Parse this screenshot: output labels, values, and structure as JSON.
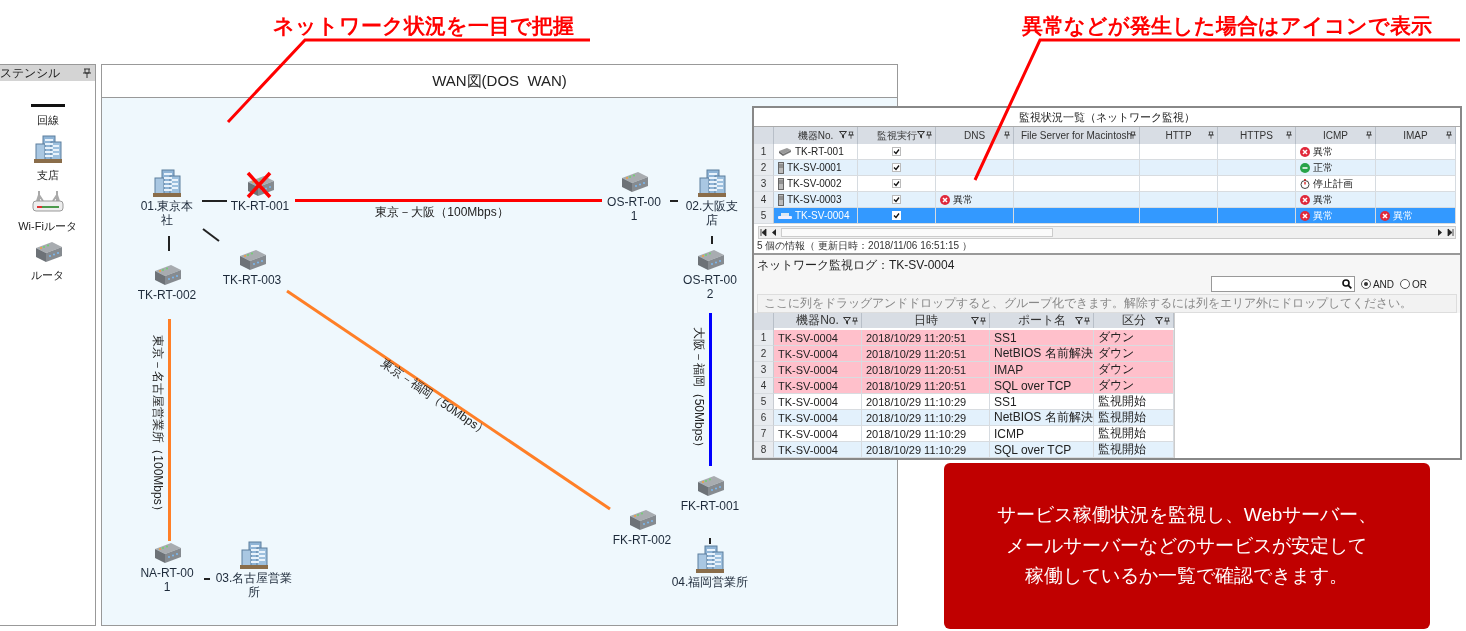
{
  "annotations": [
    {
      "text": "ネットワーク状況を一目で把握"
    },
    {
      "text": "異常などが発生した場合はアイコンで表示"
    }
  ],
  "stencil": {
    "title": "ステンシル",
    "items": [
      {
        "kind": "line",
        "label": "回線"
      },
      {
        "kind": "building",
        "label": "支店"
      },
      {
        "kind": "wifi",
        "label": "Wi-Fiルータ"
      },
      {
        "kind": "router",
        "label": "ルータ"
      }
    ]
  },
  "diagram": {
    "title": "WAN図(DOS  WAN)",
    "nodes": [
      {
        "kind": "building",
        "label": "01.東京本社",
        "alarm": false
      },
      {
        "kind": "router",
        "label": "TK-RT-001",
        "alarm": true
      },
      {
        "kind": "router",
        "label": "OS-RT-001",
        "alarm": false
      },
      {
        "kind": "building",
        "label": "02.大阪支店",
        "alarm": false
      },
      {
        "kind": "router",
        "label": "TK-RT-002",
        "alarm": false
      },
      {
        "kind": "router",
        "label": "TK-RT-003",
        "alarm": false
      },
      {
        "kind": "router",
        "label": "OS-RT-002",
        "alarm": false
      },
      {
        "kind": "router",
        "label": "FK-RT-001",
        "alarm": false
      },
      {
        "kind": "router",
        "label": "FK-RT-002",
        "alarm": false
      },
      {
        "kind": "router",
        "label": "NA-RT-001",
        "alarm": false
      },
      {
        "kind": "building",
        "label": "03.名古屋営業所",
        "alarm": false
      },
      {
        "kind": "building",
        "label": "04.福岡営業所",
        "alarm": false
      }
    ],
    "links": [
      {
        "color": "#222222"
      },
      {
        "color": "#222222"
      },
      {
        "color": "#222222"
      },
      {
        "color": "#ff0000",
        "label": "東京－大阪（100Mbps）"
      },
      {
        "color": "#ff7f27",
        "label": "東京－名古屋営業所（100Mbps）"
      },
      {
        "color": "#ff7f27",
        "label": "東京－福岡（50Mbps）"
      },
      {
        "color": "#222222"
      },
      {
        "color": "#0000ff",
        "label": "大阪－福岡（50Mbps）"
      },
      {
        "color": "#222222"
      },
      {
        "color": "#222222"
      },
      {
        "color": "#222222"
      }
    ]
  },
  "monitor": {
    "title": "監視状況一覧（ネットワーク監視）",
    "columns": [
      {
        "label": "機器No.",
        "filter": true
      },
      {
        "label": "監視実行",
        "filter": true
      },
      {
        "label": "DNS",
        "filter": false
      },
      {
        "label": "File Server for Macintosh",
        "filter": false
      },
      {
        "label": "HTTP",
        "filter": false
      },
      {
        "label": "HTTPS",
        "filter": false
      },
      {
        "label": "ICMP",
        "filter": false
      },
      {
        "label": "IMAP",
        "filter": false
      }
    ],
    "rows": [
      {
        "no": "1",
        "kind": "router",
        "device": "TK-RT-001",
        "monitored": true,
        "selected": false,
        "cells": [
          {
            "kind": "empty"
          },
          {
            "kind": "empty"
          },
          {
            "kind": "empty"
          },
          {
            "kind": "empty"
          },
          {
            "kind": "error",
            "text": "異常"
          },
          {
            "kind": "empty"
          }
        ]
      },
      {
        "no": "2",
        "kind": "server",
        "device": "TK-SV-0001",
        "monitored": true,
        "selected": false,
        "cells": [
          {
            "kind": "empty"
          },
          {
            "kind": "empty"
          },
          {
            "kind": "empty"
          },
          {
            "kind": "empty"
          },
          {
            "kind": "ok",
            "text": "正常"
          },
          {
            "kind": "empty"
          }
        ]
      },
      {
        "no": "3",
        "kind": "server",
        "device": "TK-SV-0002",
        "monitored": true,
        "selected": false,
        "cells": [
          {
            "kind": "empty"
          },
          {
            "kind": "empty"
          },
          {
            "kind": "empty"
          },
          {
            "kind": "empty"
          },
          {
            "kind": "stop",
            "text": "停止計画"
          },
          {
            "kind": "empty"
          }
        ]
      },
      {
        "no": "4",
        "kind": "server",
        "device": "TK-SV-0003",
        "monitored": true,
        "selected": false,
        "cells": [
          {
            "kind": "error",
            "text": "異常"
          },
          {
            "kind": "empty"
          },
          {
            "kind": "empty"
          },
          {
            "kind": "empty"
          },
          {
            "kind": "error",
            "text": "異常"
          },
          {
            "kind": "empty"
          }
        ]
      },
      {
        "no": "5",
        "kind": "laptop",
        "device": "TK-SV-0004",
        "monitored": true,
        "selected": true,
        "cells": [
          {
            "kind": "empty"
          },
          {
            "kind": "empty"
          },
          {
            "kind": "empty"
          },
          {
            "kind": "empty"
          },
          {
            "kind": "error",
            "text": "異常"
          },
          {
            "kind": "error",
            "text": "異常"
          }
        ]
      }
    ],
    "footer": "5 個の情報（ 更新日時：2018/11/06 16:51:15 ）",
    "log_title": "ネットワーク監視ログ：TK-SV-0004",
    "search_options": [
      {
        "label": "AND",
        "selected": true
      },
      {
        "label": "OR",
        "selected": false
      }
    ],
    "group_hint": "ここに列をドラッグアンドドロップすると、グループ化できます。解除するには列をエリア外にドロップしてください。",
    "log_columns": [
      "機器No.",
      "日時",
      "ポート名",
      "区分"
    ],
    "log_rows": [
      {
        "no": "1",
        "device": "TK-SV-0004",
        "time": "2018/10/29 11:20:51",
        "port": "SS1",
        "category": "ダウン",
        "alert": true
      },
      {
        "no": "2",
        "device": "TK-SV-0004",
        "time": "2018/10/29 11:20:51",
        "port": "NetBIOS 名前解決",
        "category": "ダウン",
        "alert": true
      },
      {
        "no": "3",
        "device": "TK-SV-0004",
        "time": "2018/10/29 11:20:51",
        "port": "IMAP",
        "category": "ダウン",
        "alert": true
      },
      {
        "no": "4",
        "device": "TK-SV-0004",
        "time": "2018/10/29 11:20:51",
        "port": "SQL over TCP",
        "category": "ダウン",
        "alert": true
      },
      {
        "no": "5",
        "device": "TK-SV-0004",
        "time": "2018/10/29 11:10:29",
        "port": "SS1",
        "category": "監視開始",
        "alert": false
      },
      {
        "no": "6",
        "device": "TK-SV-0004",
        "time": "2018/10/29 11:10:29",
        "port": "NetBIOS 名前解決",
        "category": "監視開始",
        "alert": false
      },
      {
        "no": "7",
        "device": "TK-SV-0004",
        "time": "2018/10/29 11:10:29",
        "port": "ICMP",
        "category": "監視開始",
        "alert": false
      },
      {
        "no": "8",
        "device": "TK-SV-0004",
        "time": "2018/10/29 11:10:29",
        "port": "SQL over TCP",
        "category": "監視開始",
        "alert": false
      }
    ]
  },
  "callout": {
    "lines": [
      "サービス稼働状況を監視し、Webサーバー、",
      "メールサーバーなどのサービスが安定して",
      "稼働しているか一覧で確認できます。"
    ]
  }
}
